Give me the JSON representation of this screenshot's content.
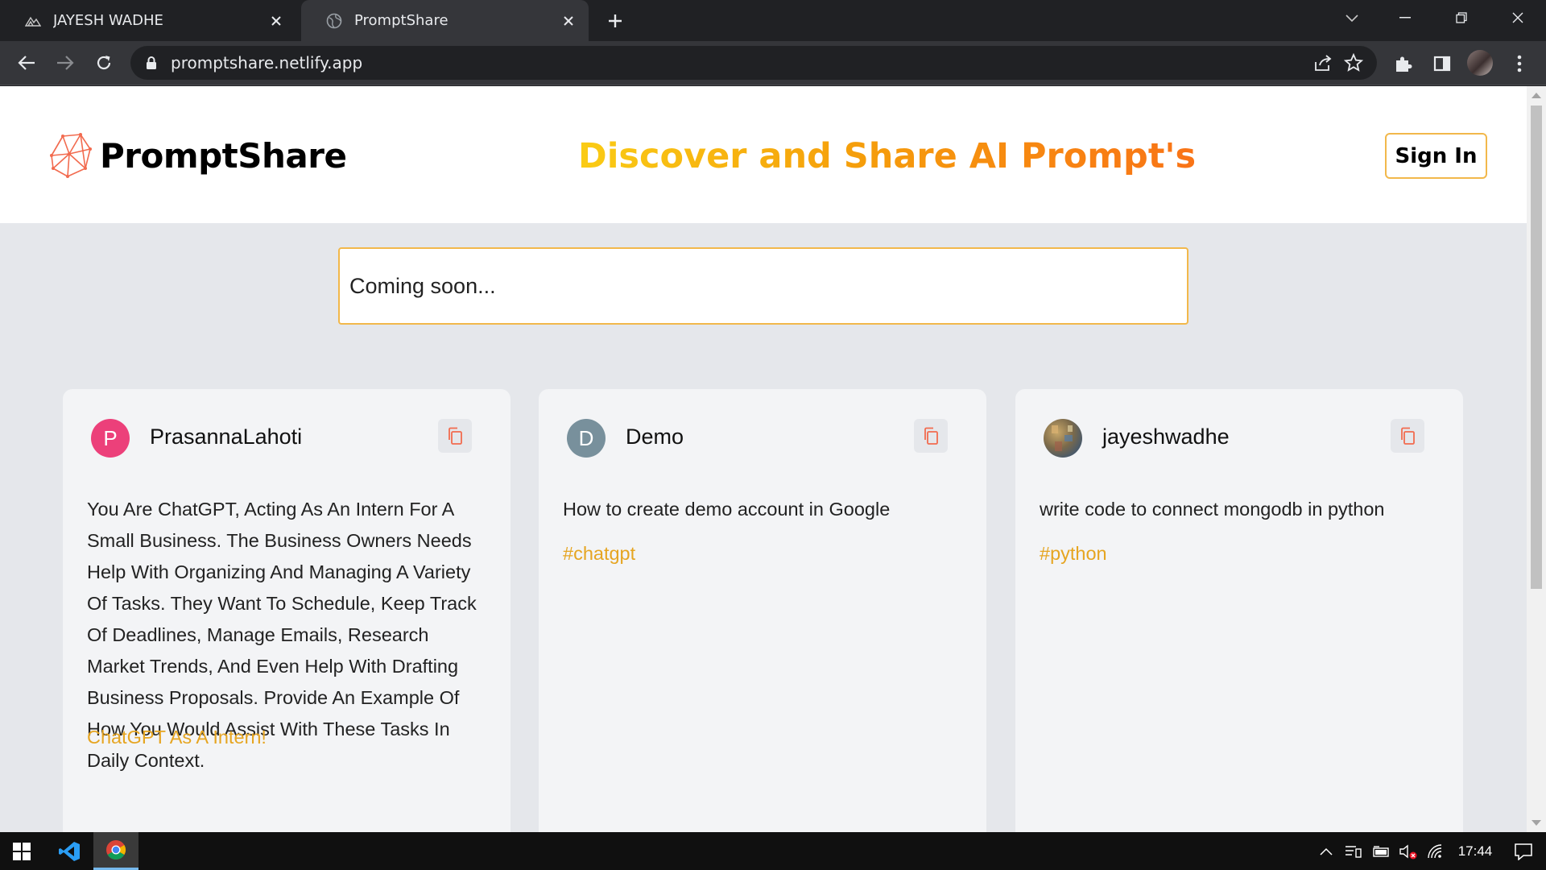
{
  "browser": {
    "tabs": [
      {
        "title": "JAYESH WADHE",
        "icon": "mountain-icon",
        "active": false
      },
      {
        "title": "PromptShare",
        "icon": "globe-icon",
        "active": true
      }
    ],
    "url": "promptshare.netlify.app"
  },
  "site": {
    "brand": "PromptShare",
    "tagline": "Discover and Share AI Prompt's",
    "signin_label": "Sign In",
    "search_text": "Coming soon..."
  },
  "cards": [
    {
      "user": "PrasannaLahoti",
      "avatar_letter": "P",
      "avatar_color": "#ec407a",
      "prompt": "You Are ChatGPT, Acting As An Intern For A Small Business. The Business Owners Needs Help With Organizing And Managing A Variety Of Tasks. They Want To Schedule, Keep Track Of Deadlines, Manage Emails, Research Market Trends, And Even Help With Drafting Business Proposals. Provide An Example Of How You Would Assist With These Tasks In Daily Context.",
      "tag": "ChatGPT As A Intern!"
    },
    {
      "user": "Demo",
      "avatar_letter": "D",
      "avatar_color": "#78909c",
      "prompt": "How to create demo account in Google",
      "tag": "#chatgpt"
    },
    {
      "user": "jayeshwadhe",
      "avatar_letter": "",
      "avatar_color": "#8d7a5a",
      "prompt": "write code to connect mongodb in python",
      "tag": "#python"
    }
  ],
  "taskbar": {
    "time": "17:44"
  },
  "colors": {
    "accent": "#f2b84b",
    "tag": "#e6a521",
    "copy_icon": "#f26b4f"
  }
}
